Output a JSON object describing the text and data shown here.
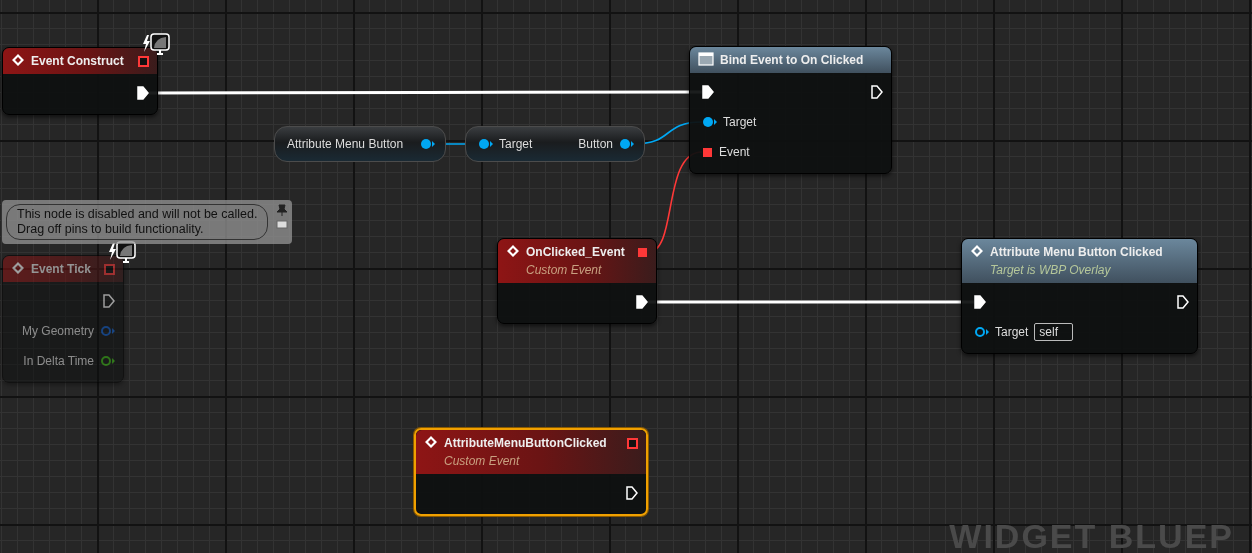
{
  "graph": {
    "nodes": [
      {
        "kind": "event",
        "title": "Event Construct",
        "selected": false,
        "disabled": false,
        "replicated_icon": true,
        "delegate_pin": {
          "connected": false
        },
        "outputs": [
          {
            "kind": "exec",
            "connected": true
          }
        ]
      },
      {
        "kind": "getter",
        "title": "Attribute Menu Button",
        "selected": false,
        "disabled": false,
        "outputs": [
          {
            "kind": "object",
            "connected": true
          }
        ]
      },
      {
        "kind": "cast",
        "selected": false,
        "disabled": false,
        "inputs": [
          {
            "kind": "object",
            "label": "Target",
            "connected": true
          }
        ],
        "outputs": [
          {
            "kind": "object",
            "label": "Button",
            "connected": true
          }
        ]
      },
      {
        "kind": "bind",
        "title": "Bind Event to On Clicked",
        "selected": false,
        "disabled": false,
        "inputs": [
          {
            "kind": "exec",
            "connected": true
          },
          {
            "kind": "object",
            "label": "Target",
            "connected": true
          },
          {
            "kind": "delegate",
            "label": "Event",
            "connected": true
          }
        ],
        "outputs": [
          {
            "kind": "exec",
            "connected": false
          }
        ]
      },
      {
        "kind": "event",
        "title": "Event Tick",
        "selected": false,
        "disabled": true,
        "replicated_icon": true,
        "comment": "This node is disabled and will not be called.\nDrag off pins to build functionality.",
        "delegate_pin": {
          "connected": false
        },
        "outputs": [
          {
            "kind": "exec",
            "connected": false
          },
          {
            "kind": "struct",
            "label": "My Geometry",
            "connected": false
          },
          {
            "kind": "float",
            "label": "In Delta Time",
            "connected": false
          }
        ]
      },
      {
        "kind": "event",
        "title": "OnClicked_Event",
        "subtitle": "Custom Event",
        "selected": false,
        "disabled": false,
        "delegate_pin": {
          "connected": true
        },
        "outputs": [
          {
            "kind": "exec",
            "connected": true
          }
        ]
      },
      {
        "kind": "call",
        "title": "Attribute Menu Button Clicked",
        "subtitle": "Target is WBP Overlay",
        "selected": false,
        "disabled": false,
        "inputs": [
          {
            "kind": "exec",
            "connected": true
          },
          {
            "kind": "object",
            "label": "Target",
            "connected": false,
            "value": "self"
          }
        ],
        "outputs": [
          {
            "kind": "exec",
            "connected": false
          }
        ]
      },
      {
        "kind": "event",
        "title": "AttributeMenuButtonClicked",
        "subtitle": "Custom Event",
        "selected": true,
        "disabled": false,
        "delegate_pin": {
          "connected": false
        },
        "outputs": [
          {
            "kind": "exec",
            "connected": false
          }
        ]
      }
    ],
    "graph_label": "WIDGET BLUEP"
  }
}
